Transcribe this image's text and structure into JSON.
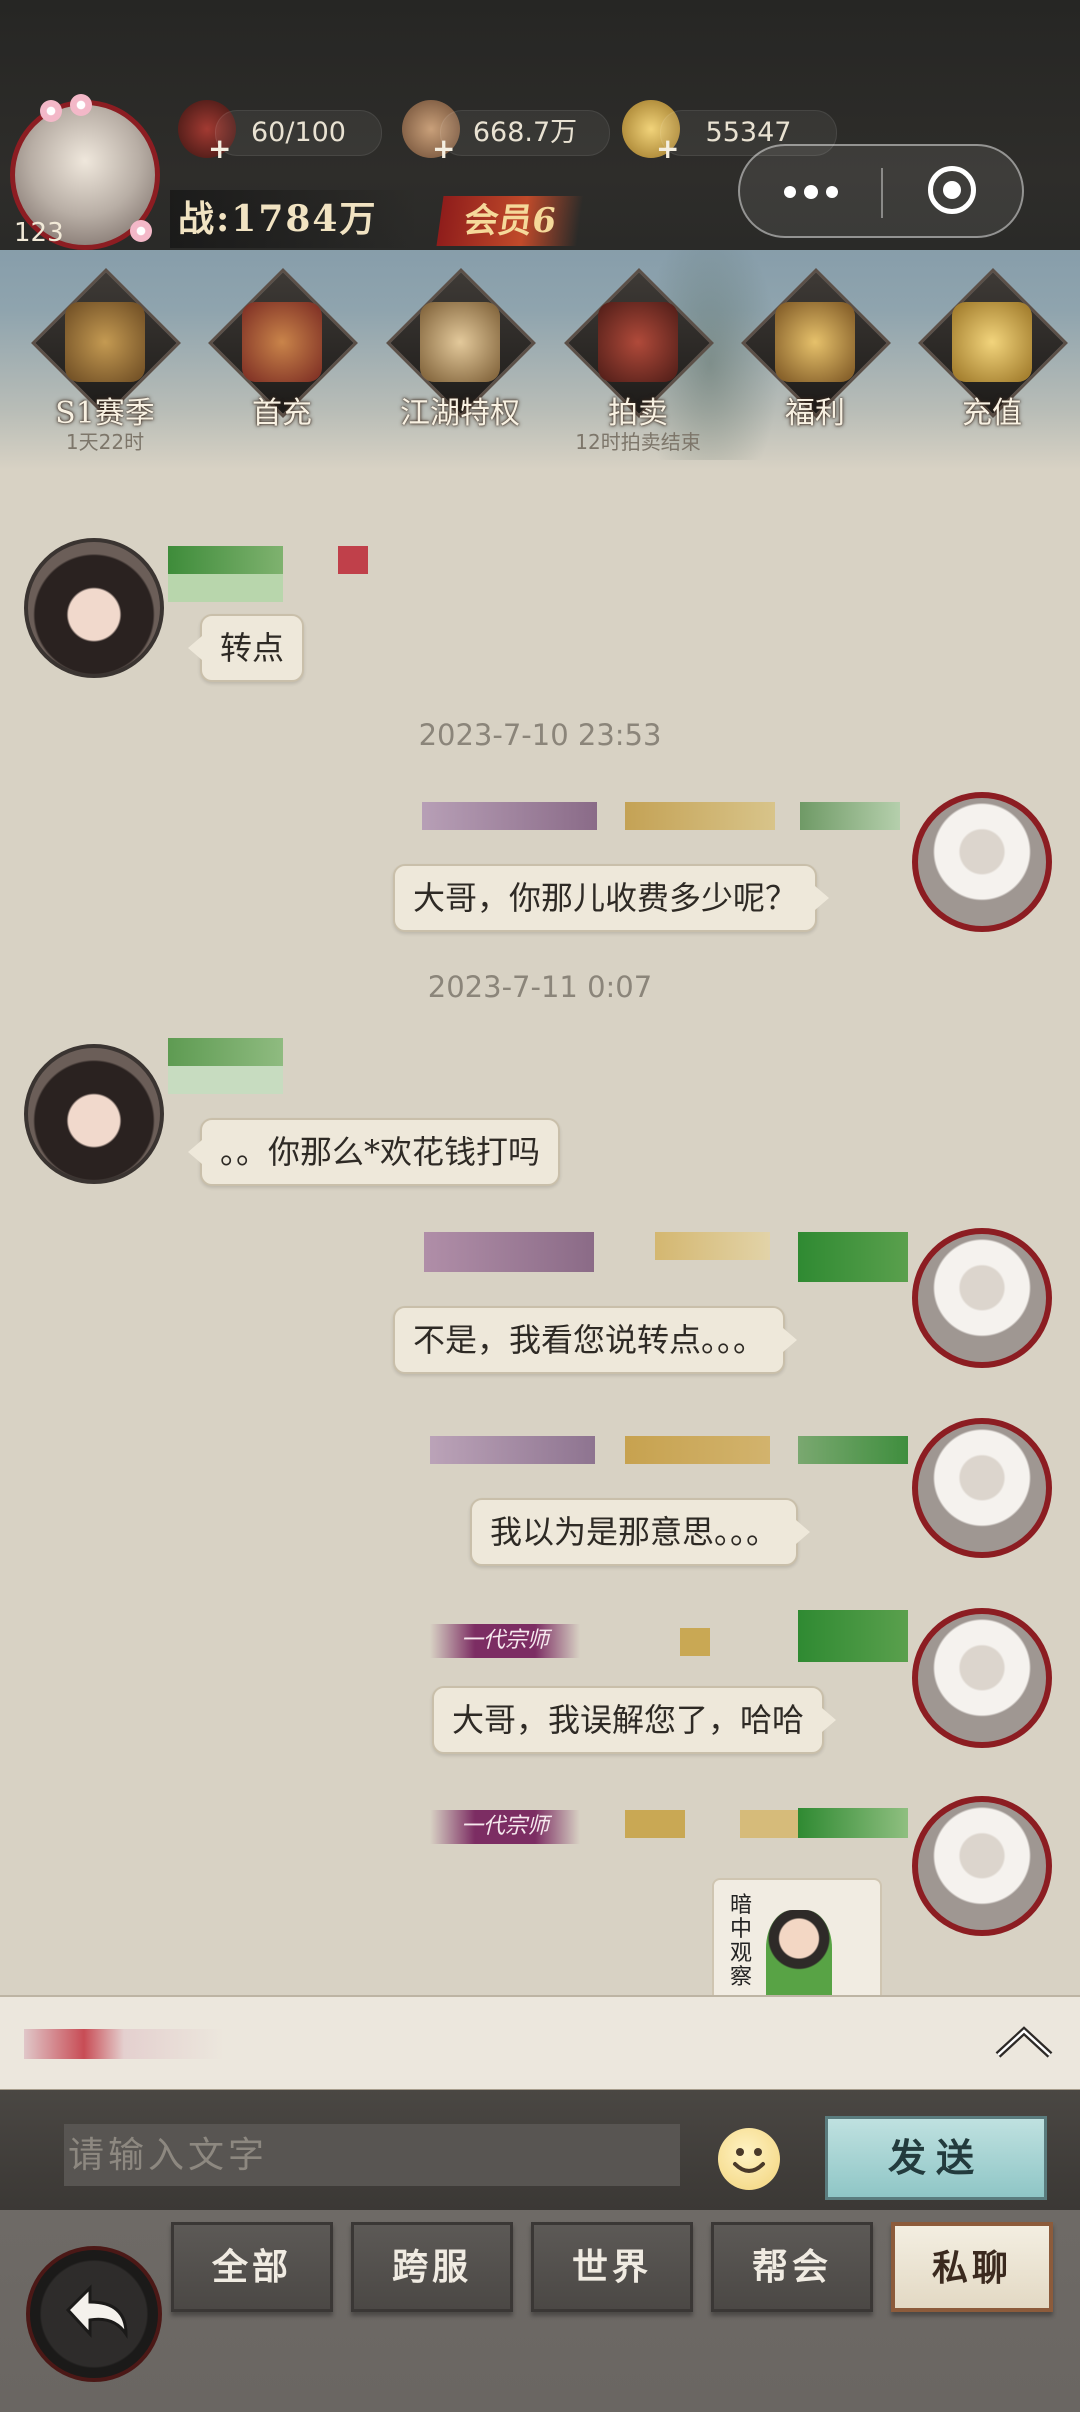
{
  "header": {
    "player_level": "123",
    "resources": [
      {
        "name": "stamina",
        "icon": "wine-jar-icon",
        "value": "60/100"
      },
      {
        "name": "coins",
        "icon": "copper-coin-icon",
        "value": "668.7万"
      },
      {
        "name": "ingots",
        "icon": "gold-ingot-icon",
        "value": "55347"
      }
    ],
    "power": "战:1784万",
    "vip": "会员6"
  },
  "functions": [
    {
      "label": "S1赛季",
      "sub": "1天22时",
      "icon": "crossed-swords-icon"
    },
    {
      "label": "首充",
      "sub": "",
      "icon": "treasure-chest-icon"
    },
    {
      "label": "江湖特权",
      "sub": "",
      "icon": "scroll-book-icon"
    },
    {
      "label": "拍卖",
      "sub": "12时拍卖结束",
      "icon": "auction-gavel-icon"
    },
    {
      "label": "福利",
      "sub": "",
      "icon": "gold-box-icon"
    },
    {
      "label": "充值",
      "sub": "",
      "icon": "gold-ingot-icon"
    }
  ],
  "chat": {
    "messages": [
      {
        "text": "转点"
      },
      {
        "text": "大哥，你那儿收费多少呢？"
      },
      {
        "text": "。。你那么*欢花钱打吗"
      },
      {
        "text": "不是，我看您说转点。。。"
      },
      {
        "text": "我以为是那意思。。。"
      },
      {
        "text": "大哥，我误解您了，哈哈"
      }
    ],
    "timestamps": [
      "2023-7-10 23:53",
      "2023-7-11 0:07"
    ],
    "title_tag": "一代宗师",
    "sticker_text": "暗中观察"
  },
  "input": {
    "placeholder": "请输入文字",
    "send_label": "发送"
  },
  "tabs": [
    "全部",
    "跨服",
    "世界",
    "帮会",
    "私聊"
  ],
  "active_tab": "私聊",
  "colors": {
    "parchment": "#d8d2c4",
    "bubble": "#eee8da",
    "avatar_ring": "#8c1d22",
    "send_button": "#8fc6c6",
    "title_tag": "#7c2d63"
  }
}
